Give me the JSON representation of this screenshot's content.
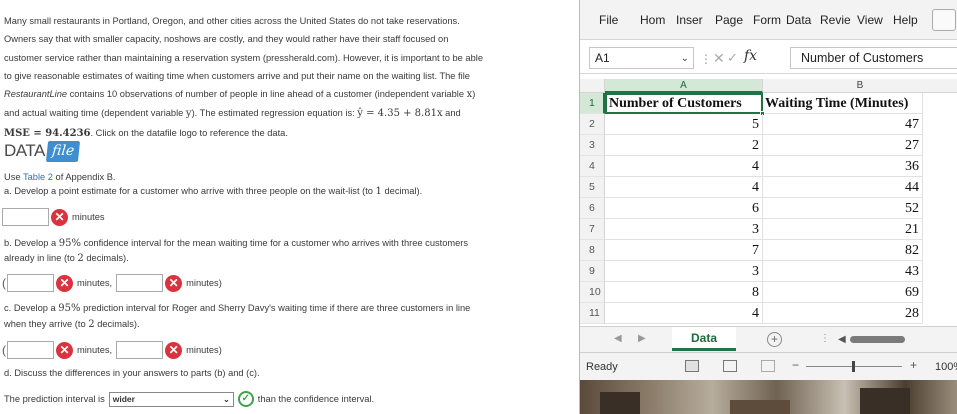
{
  "question": {
    "intro_lines": [
      "Many small restaurants in Portland, Oregon, and other cities across the United States do not take reservations.",
      "Owners say that with smaller capacity, noshows are costly, and they would rather have their staff focused on",
      "customer service rather than maintaining a reservation system (pressherald.com). However, it is important to be able",
      "to give reasonable estimates of waiting time when customers arrive and put their name on the waiting list. The file"
    ],
    "line5_italic": "RestaurantLine",
    "line5_rest": " contains 10 observations of number of people in line ahead of a customer (independent variable ",
    "line5_var": "x",
    "line5_end": ")",
    "line6_start": "and actual waiting time (dependent variable ",
    "line6_var": "y",
    "line6_mid": "). The estimated regression equation is: ",
    "equation": "ŷ = 4.35 + 8.81x",
    "line6_end": " and",
    "mse_label": "MSE = 94.4236",
    "line7_rest": ". Click on the datafile logo to reference the data.",
    "datafile_text": "DATA",
    "datafile_badge": "file",
    "use_prefix": "Use ",
    "use_link": "Table 2",
    "use_suffix": " of Appendix B.",
    "part_a": "a. Develop a point estimate for a customer who arrive with three people on the wait-list (to ",
    "part_a_num": "1",
    "part_a_end": " decimal).",
    "minutes_label": "minutes",
    "part_b_line1_start": "b. Develop a ",
    "part_b_pct": "95%",
    "part_b_line1_end": " confidence interval for the mean waiting time for a customer who arrives with three customers",
    "part_b_line2_start": "already in line (to ",
    "part_b_num": "2",
    "part_b_line2_end": " decimals).",
    "interval_minutes1": "minutes,",
    "interval_minutes2": "minutes)",
    "part_c_line1_start": "c. Develop a ",
    "part_c_pct": "95%",
    "part_c_line1_end": " prediction interval for Roger and Sherry Davy's waiting time if there are three customers in line",
    "part_c_line2_start": "when they arrive (to ",
    "part_c_num": "2",
    "part_c_line2_end": " decimals).",
    "part_d": "d. Discuss the differences in your answers to parts (b) and (c).",
    "d_prefix": "The prediction interval is",
    "d_select": "wider",
    "d_suffix": "than the confidence interval.",
    "paren_open": "(",
    "wrong_glyph": "✕",
    "correct_glyph": "✓"
  },
  "excel": {
    "menu": [
      "File",
      "Hom",
      "Inser",
      "Page",
      "Form",
      "Data",
      "Revie",
      "View",
      "Help"
    ],
    "name_box": "A1",
    "formula_value": "Number of Customers",
    "columns": [
      "A",
      "B"
    ],
    "rows": [
      {
        "n": "1",
        "a": "Number of Customers",
        "b": "Waiting Time (Minutes)"
      },
      {
        "n": "2",
        "a": "5",
        "b": "47"
      },
      {
        "n": "3",
        "a": "2",
        "b": "27"
      },
      {
        "n": "4",
        "a": "4",
        "b": "36"
      },
      {
        "n": "5",
        "a": "4",
        "b": "44"
      },
      {
        "n": "6",
        "a": "6",
        "b": "52"
      },
      {
        "n": "7",
        "a": "3",
        "b": "21"
      },
      {
        "n": "8",
        "a": "7",
        "b": "82"
      },
      {
        "n": "9",
        "a": "3",
        "b": "43"
      },
      {
        "n": "10",
        "a": "8",
        "b": "69"
      },
      {
        "n": "11",
        "a": "4",
        "b": "28"
      }
    ],
    "sheet_tab": "Data",
    "status": "Ready",
    "zoom": "100%",
    "accent_color": "#217346"
  },
  "icons": {
    "wrong": "x-circle-icon",
    "correct": "check-circle-icon",
    "dropdown": "chevron-down-icon",
    "fx": "function-icon"
  }
}
